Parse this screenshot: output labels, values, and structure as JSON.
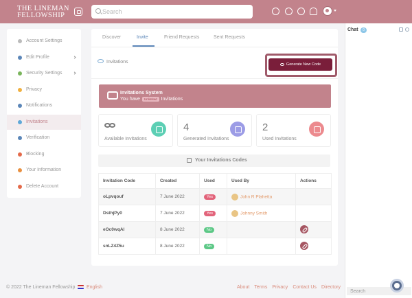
{
  "brand": {
    "logo_line1": "The Lineman",
    "logo_line2": "Fellowship"
  },
  "header": {
    "search_placeholder": "Search"
  },
  "chat": {
    "title": "Chat",
    "count": "0",
    "search_placeholder": "Search"
  },
  "sidebar": {
    "items": [
      {
        "label": "Account Settings",
        "icon": "gear-icon",
        "color": "#bbbbbb"
      },
      {
        "label": "Edit Profile",
        "icon": "user-icon",
        "color": "#5b86b8"
      },
      {
        "label": "Security Settings",
        "icon": "shield-icon",
        "color": "#7ab55c"
      },
      {
        "label": "Privacy",
        "icon": "lock-icon",
        "color": "#f0b040"
      },
      {
        "label": "Notifications",
        "icon": "bell-icon",
        "color": "#5b86b8"
      },
      {
        "label": "Invitations",
        "icon": "eye-icon",
        "color": "#5fa8d8"
      },
      {
        "label": "Verification",
        "icon": "check-icon",
        "color": "#5b86b8"
      },
      {
        "label": "Blocking",
        "icon": "block-icon",
        "color": "#e46a4a"
      },
      {
        "label": "Your Information",
        "icon": "info-icon",
        "color": "#e89040"
      },
      {
        "label": "Delete Account",
        "icon": "trash-icon",
        "color": "#e46a4a"
      }
    ]
  },
  "tabs": [
    "Discover",
    "Invite",
    "Friend Requests",
    "Sent Requests"
  ],
  "section": {
    "title": "Invitations",
    "generate_label": "Generate New Code"
  },
  "banner": {
    "title": "Invitations System",
    "prefix": "You have",
    "badge": "Unlimited",
    "suffix": "Invitations"
  },
  "stats": [
    {
      "value": "",
      "label": "Available Invitations",
      "color": "#5ccfb4"
    },
    {
      "value": "4",
      "label": "Generated Invitations",
      "color": "#9c9ce6"
    },
    {
      "value": "2",
      "label": "Used Invitations",
      "color": "#ec8a8e"
    }
  ],
  "codes": {
    "title": "Your Invitations Codes",
    "headers": [
      "Invitation Code",
      "Created",
      "Used",
      "Used By",
      "Actions"
    ],
    "rows": [
      {
        "code": "oLpvqouf",
        "created": "7 June 2022",
        "used": "Yes",
        "used_by": "John R Plahetta",
        "action": false
      },
      {
        "code": "DsthjPy0",
        "created": "7 June 2022",
        "used": "Yes",
        "used_by": "Johnny Smith",
        "action": false
      },
      {
        "code": "eOc0wqAl",
        "created": "8 June 2022",
        "used": "No",
        "used_by": "",
        "action": true
      },
      {
        "code": "snLZ4Z5u",
        "created": "8 June 2022",
        "used": "No",
        "used_by": "",
        "action": true
      }
    ],
    "colors": {
      "yes": "#e2637a",
      "no": "#5cc886"
    }
  },
  "footer": {
    "copyright": "© 2022 The Lineman Fellowship",
    "language": "English",
    "links": [
      "About",
      "Terms",
      "Privacy",
      "Contact Us",
      "Directory"
    ]
  }
}
